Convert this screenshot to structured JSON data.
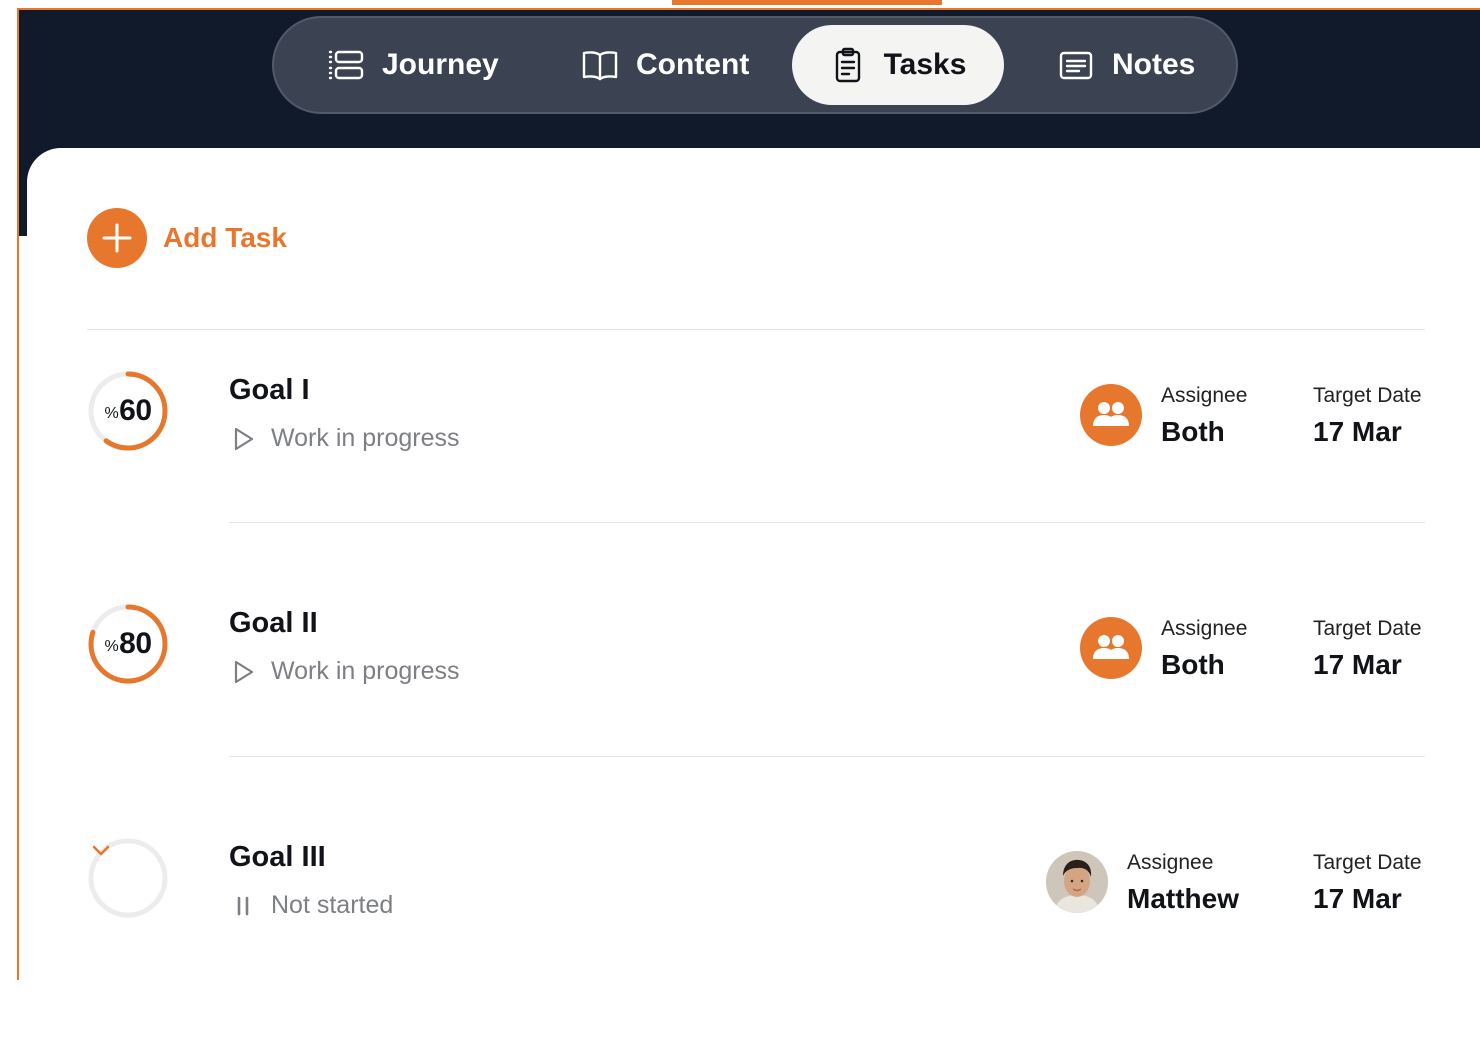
{
  "nav": {
    "items": [
      {
        "label": "Journey",
        "icon": "journey-list-icon",
        "active": false
      },
      {
        "label": "Content",
        "icon": "book-icon",
        "active": false
      },
      {
        "label": "Tasks",
        "icon": "clipboard-icon",
        "active": true
      },
      {
        "label": "Notes",
        "icon": "notes-icon",
        "active": false
      }
    ]
  },
  "add_task": {
    "label": "Add Task",
    "icon": "plus-icon"
  },
  "labels": {
    "assignee": "Assignee",
    "target_date": "Target Date"
  },
  "tasks": [
    {
      "title": "Goal I",
      "status": "Work in progress",
      "status_icon": "play-icon",
      "progress": 60,
      "progress_label": "60",
      "percent_sign": "%",
      "assignee": "Both",
      "assignee_icon": "group-icon",
      "target_date": "17 Mar"
    },
    {
      "title": "Goal II",
      "status": "Work in progress",
      "status_icon": "play-icon",
      "progress": 80,
      "progress_label": "80",
      "percent_sign": "%",
      "assignee": "Both",
      "assignee_icon": "group-icon",
      "target_date": "17 Mar"
    },
    {
      "title": "Goal III",
      "status": "Not started",
      "status_icon": "pause-icon",
      "progress": 0,
      "expand_icon": "chevron-down-icon",
      "assignee": "Matthew",
      "assignee_icon": "avatar-photo",
      "target_date": "17 Mar"
    }
  ],
  "colors": {
    "accent": "#e8772e",
    "header_bg": "#111a2b",
    "nav_pill": "#3b4252",
    "muted_text": "#7d7f85",
    "ring_track": "#ececec"
  }
}
